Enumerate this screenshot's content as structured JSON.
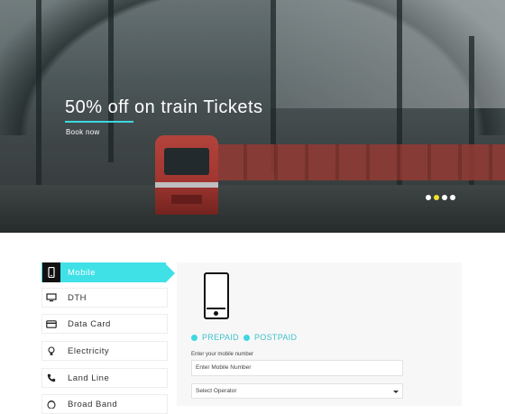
{
  "hero": {
    "title": "50% off on train Tickets",
    "cta": "Book now",
    "carousel": {
      "slide_count": 4,
      "active_index": 1
    }
  },
  "sidebar": {
    "items": [
      {
        "label": "Mobile",
        "icon": "mobile-phone-icon",
        "active": true
      },
      {
        "label": "DTH",
        "icon": "monitor-icon",
        "active": false
      },
      {
        "label": "Data Card",
        "icon": "card-icon",
        "active": false
      },
      {
        "label": "Electricity",
        "icon": "lightbulb-icon",
        "active": false
      },
      {
        "label": "Land Line",
        "icon": "telephone-icon",
        "active": false
      },
      {
        "label": "Broad Band",
        "icon": "router-icon",
        "active": false
      }
    ]
  },
  "recharge": {
    "options": [
      {
        "label": "PREPAID",
        "selected": true
      },
      {
        "label": "POSTPAID",
        "selected": false
      }
    ],
    "mobile_label": "Enter your mobile number",
    "mobile_placeholder": "Enter Mobile Number",
    "operator_value": "Select Operator"
  },
  "colors": {
    "accent": "#3fe0e6",
    "active_dot": "#f0e02c"
  }
}
